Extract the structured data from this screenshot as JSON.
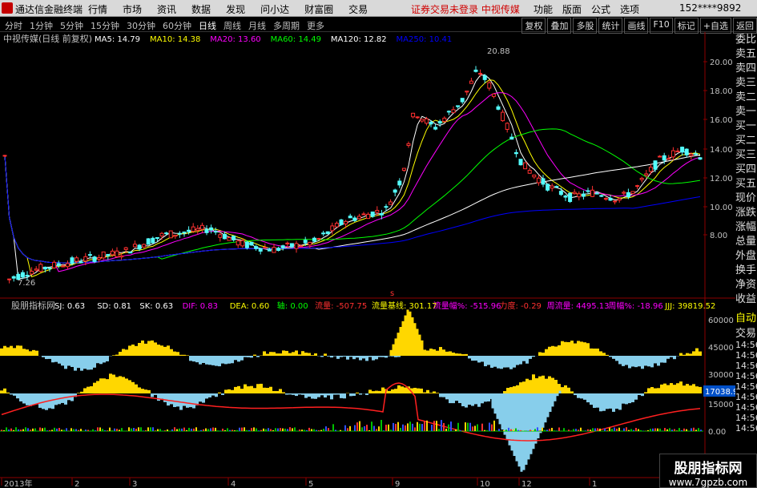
{
  "titlebar": {
    "app_name": "通达信金融终端",
    "menu": [
      "行情",
      "市场",
      "资讯",
      "数据",
      "发现",
      "问小达",
      "财富圈",
      "交易"
    ],
    "warning": "证券交易未登录  中视传媒",
    "right_menu": [
      "功能",
      "版面",
      "公式",
      "选项"
    ],
    "user": "152****9892",
    "win_buttons": [
      "_",
      "□",
      "×"
    ]
  },
  "timeframes": {
    "items": [
      "分时",
      "1分钟",
      "5分钟",
      "15分钟",
      "30分钟",
      "60分钟",
      "日线",
      "周线",
      "月线",
      "多周期",
      "更多"
    ],
    "active": "日线"
  },
  "toolbar_right": [
    "复权",
    "叠加",
    "多股",
    "统计",
    "画线",
    "F10",
    "标记",
    "+自选",
    "返回"
  ],
  "side_tabs": [
    "委比",
    "卖五",
    "卖四",
    "卖三",
    "卖二",
    "卖一",
    "买一",
    "买二",
    "买三",
    "买四",
    "买五",
    "现价",
    "涨跌",
    "涨幅",
    "总量",
    "外盘",
    "换手",
    "净资",
    "收益"
  ],
  "side_tabs2": [
    "自动",
    "交易",
    "14:56",
    "14:56",
    "14:56",
    "14:56",
    "14:56",
    "14:56",
    "14:56",
    "14:56",
    "14:56"
  ],
  "main_legend": {
    "stock": "中视传媒(日线 前复权)",
    "mas": [
      {
        "label": "MA5: 14.79",
        "color": "#ffffff"
      },
      {
        "label": "MA10: 14.38",
        "color": "#ffff00"
      },
      {
        "label": "MA20: 13.60",
        "color": "#ff00ff"
      },
      {
        "label": "MA60: 14.49",
        "color": "#00ff00"
      },
      {
        "label": "MA120: 12.82",
        "color": "#ffffff"
      },
      {
        "label": "MA250: 10.41",
        "color": "#0000ff"
      }
    ]
  },
  "price_axis": [
    "20.00",
    "18.00",
    "16.00",
    "14.00",
    "12.00",
    "10.00",
    "8.00"
  ],
  "price_annotations": {
    "high": "20.88",
    "low": "7.26"
  },
  "sub_legend": {
    "title": "股朋指标网",
    "items": [
      {
        "label": "SJ: 0.63",
        "color": "#ffffff"
      },
      {
        "label": "SD: 0.81",
        "color": "#ffffff"
      },
      {
        "label": "SK: 0.63",
        "color": "#ffffff"
      },
      {
        "label": "DIF: 0.83",
        "color": "#ff00ff"
      },
      {
        "label": "DEA: 0.60",
        "color": "#ffff00"
      },
      {
        "label": "轴: 0.00",
        "color": "#00ff00"
      },
      {
        "label": "流量: -507.75",
        "color": "#ff3030"
      },
      {
        "label": "流量基线: 301.17",
        "color": "#ffff00"
      },
      {
        "label": "流量幅%: -515.96",
        "color": "#ff00ff"
      },
      {
        "label": "力度: -0.29",
        "color": "#ff3030"
      },
      {
        "label": "周流量: 4495.13",
        "color": "#ff00ff"
      },
      {
        "label": "周幅%: -18.96",
        "color": "#ff00ff"
      },
      {
        "label": "JJJ: 39819.52",
        "color": "#ffff00"
      }
    ]
  },
  "sub_axis": [
    "60000",
    "45000",
    "30000",
    "15000",
    "0.00"
  ],
  "sub_value_box": "17038.96",
  "x_axis": [
    "2013年",
    "2",
    "3",
    "4",
    "5",
    "9",
    "10",
    "12",
    "1"
  ],
  "watermark": {
    "line1": "股朋指标网",
    "line2": "www.7gpzb.com"
  },
  "marker_letter": "s"
}
